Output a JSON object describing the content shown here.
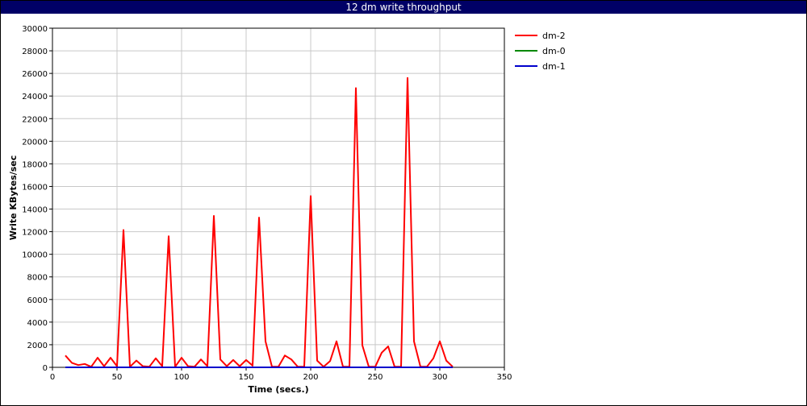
{
  "window": {
    "title": "12 dm write throughput"
  },
  "colors": {
    "title_bar": "#000066",
    "dm-2": "#ff0000",
    "dm-0": "#008800",
    "dm-1": "#0000cc"
  },
  "chart_data": {
    "type": "line",
    "title": "12 dm write throughput",
    "xlabel": "Time (secs.)",
    "ylabel": "Write KBytes/sec",
    "xlim": [
      0,
      350
    ],
    "ylim": [
      0,
      30000
    ],
    "xticks": [
      0,
      50,
      100,
      150,
      200,
      250,
      300,
      350
    ],
    "yticks": [
      0,
      2000,
      4000,
      6000,
      8000,
      10000,
      12000,
      14000,
      16000,
      18000,
      20000,
      22000,
      24000,
      26000,
      28000,
      30000
    ],
    "grid": true,
    "legend_position": "top-right outside plot",
    "series": [
      {
        "name": "dm-2",
        "color": "#ff0000",
        "x": [
          10,
          15,
          20,
          25,
          30,
          35,
          40,
          45,
          50,
          55,
          60,
          65,
          70,
          75,
          80,
          85,
          90,
          95,
          100,
          105,
          110,
          115,
          120,
          125,
          130,
          135,
          140,
          145,
          150,
          155,
          160,
          165,
          170,
          175,
          180,
          185,
          190,
          195,
          200,
          205,
          210,
          215,
          220,
          225,
          230,
          235,
          240,
          245,
          250,
          255,
          260,
          265,
          270,
          275,
          280,
          285,
          290,
          295,
          300,
          305,
          310
        ],
        "y": [
          1050,
          400,
          200,
          300,
          50,
          850,
          100,
          850,
          100,
          12150,
          50,
          600,
          100,
          50,
          800,
          100,
          11600,
          50,
          850,
          100,
          50,
          700,
          100,
          13400,
          700,
          100,
          650,
          100,
          650,
          150,
          13250,
          2300,
          50,
          50,
          1050,
          700,
          50,
          50,
          15150,
          600,
          50,
          550,
          2300,
          50,
          50,
          24700,
          1950,
          50,
          50,
          1300,
          1850,
          50,
          50,
          25600,
          2300,
          50,
          50,
          800,
          2300,
          600,
          50
        ]
      },
      {
        "name": "dm-0",
        "color": "#008800",
        "x": [
          10,
          310
        ],
        "y": [
          0,
          0
        ]
      },
      {
        "name": "dm-1",
        "color": "#0000cc",
        "x": [
          10,
          310
        ],
        "y": [
          0,
          0
        ]
      }
    ]
  }
}
